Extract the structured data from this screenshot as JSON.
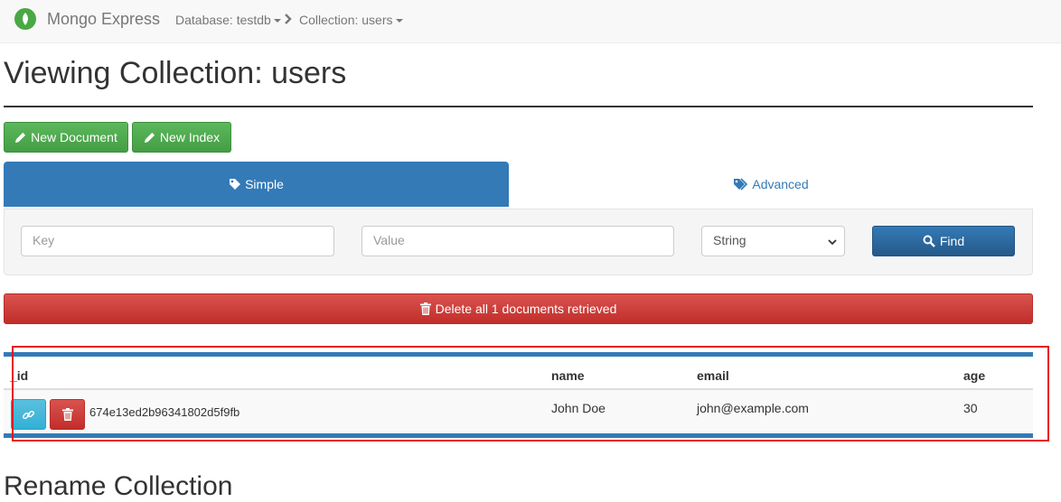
{
  "navbar": {
    "brand": "Mongo Express",
    "database_crumb": "Database: testdb",
    "collection_crumb": "Collection: users"
  },
  "page": {
    "title": "Viewing Collection: users"
  },
  "toolbar": {
    "new_document_label": "New Document",
    "new_index_label": "New Index"
  },
  "search_tabs": {
    "simple_label": "Simple",
    "advanced_label": "Advanced"
  },
  "search": {
    "key_placeholder": "Key",
    "value_placeholder": "Value",
    "type_selected": "String",
    "find_label": "Find"
  },
  "delete_all_label": "Delete all 1 documents retrieved",
  "table": {
    "columns": [
      "_id",
      "name",
      "email",
      "age"
    ],
    "rows": [
      {
        "_id": "674e13ed2b96341802d5f9fb",
        "name": "John Doe",
        "email": "john@example.com",
        "age": "30"
      }
    ]
  },
  "rename_section": {
    "title": "Rename Collection"
  },
  "colors": {
    "primary": "#337ab7",
    "success": "#5cb85c",
    "danger": "#d9534f",
    "info": "#5bc0de",
    "highlight": "#e8141a"
  },
  "icons": {
    "logo": "leaf-icon",
    "new_document": "pencil-icon",
    "new_index": "pencil-icon",
    "simple_tab": "tag-icon",
    "advanced_tab": "tags-icon",
    "find": "search-icon",
    "delete_all": "trash-icon",
    "row_view": "link-icon",
    "row_delete": "trash-icon"
  }
}
